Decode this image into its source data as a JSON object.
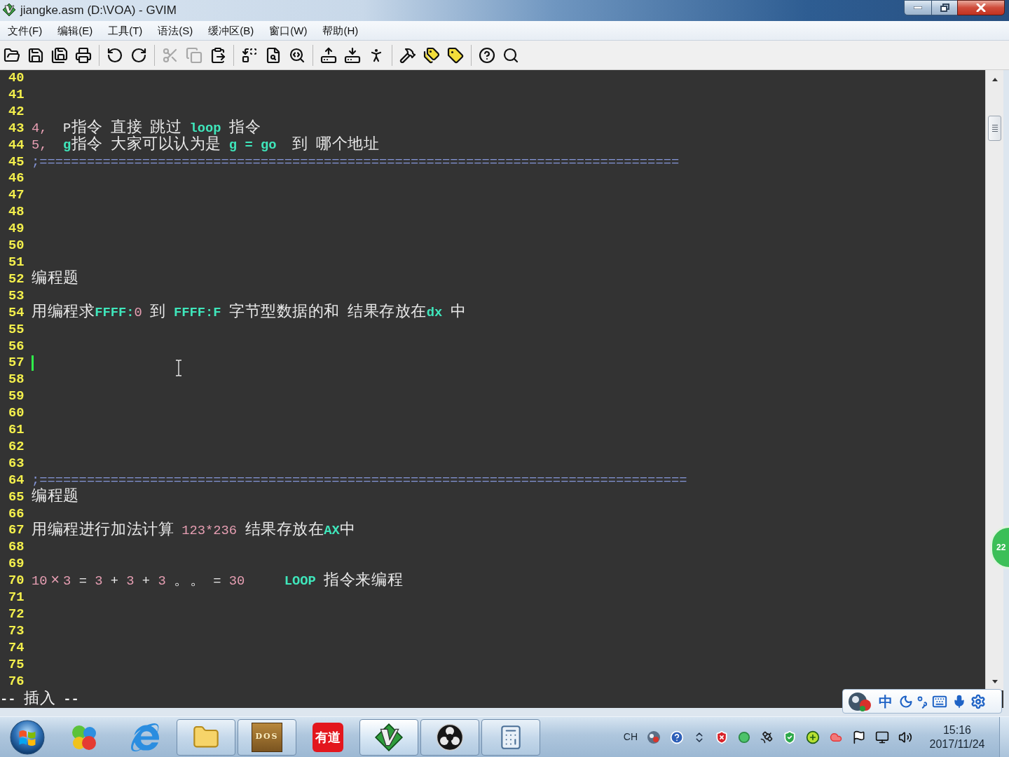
{
  "window": {
    "title": "jiangke.asm (D:\\VOA) - GVIM"
  },
  "menu": [
    "文件(F)",
    "编辑(E)",
    "工具(T)",
    "语法(S)",
    "缓冲区(B)",
    "窗口(W)",
    "帮助(H)"
  ],
  "toolbar": [
    {
      "buttons": [
        {
          "disabled": false
        },
        {
          "disabled": false
        },
        {
          "disabled": false
        },
        {
          "disabled": false
        }
      ]
    },
    {
      "buttons": [
        {
          "disabled": false
        },
        {
          "disabled": false
        }
      ]
    },
    {
      "buttons": [
        {
          "disabled": true
        },
        {
          "disabled": true
        },
        {
          "disabled": false
        }
      ]
    },
    {
      "buttons": [
        {
          "disabled": false
        },
        {
          "disabled": false
        },
        {
          "disabled": false
        }
      ]
    },
    {
      "buttons": [
        {
          "disabled": false
        },
        {
          "disabled": false
        },
        {
          "disabled": false
        }
      ]
    },
    {
      "buttons": [
        {
          "disabled": false
        },
        {
          "disabled": false
        },
        {
          "disabled": false
        }
      ]
    },
    {
      "buttons": [
        {
          "disabled": false
        },
        {
          "disabled": false
        }
      ]
    }
  ],
  "editor": {
    "lines": [
      {
        "number": "40",
        "cursor": false
      },
      {
        "number": "41",
        "cursor": false
      },
      {
        "number": "42",
        "cursor": false
      },
      {
        "number": "43",
        "cursor": false,
        "segments": [
          {
            "text": "4,",
            "kind": "number"
          },
          {
            "text": "  P指令 直接 跳过 ",
            "kind": "plain"
          },
          {
            "text": "loop",
            "kind": "keyword"
          },
          {
            "text": " 指令",
            "kind": "plain"
          }
        ]
      },
      {
        "number": "44",
        "cursor": false,
        "segments": [
          {
            "text": "5,",
            "kind": "number"
          },
          {
            "text": "  g",
            "kind": "keyword"
          },
          {
            "text": "指令 大家可以认为是 ",
            "kind": "plain"
          },
          {
            "text": "g = go",
            "kind": "keyword"
          },
          {
            "text": "  到 哪个地址",
            "kind": "plain"
          }
        ]
      },
      {
        "number": "45",
        "cursor": false,
        "segments": [
          {
            "text": ";=================================================================================",
            "kind": "comment"
          }
        ]
      },
      {
        "number": "46",
        "cursor": false
      },
      {
        "number": "47",
        "cursor": false
      },
      {
        "number": "48",
        "cursor": false
      },
      {
        "number": "49",
        "cursor": false
      },
      {
        "number": "50",
        "cursor": false
      },
      {
        "number": "51",
        "cursor": false
      },
      {
        "number": "52",
        "cursor": false,
        "segments": [
          {
            "text": "编程题",
            "kind": "plain"
          }
        ]
      },
      {
        "number": "53",
        "cursor": false
      },
      {
        "number": "54",
        "cursor": false,
        "segments": [
          {
            "text": "用编程求",
            "kind": "plain"
          },
          {
            "text": "FFFF:",
            "kind": "keyword"
          },
          {
            "text": "0",
            "kind": "number"
          },
          {
            "text": " 到 ",
            "kind": "plain"
          },
          {
            "text": "FFFF:F",
            "kind": "keyword"
          },
          {
            "text": " 字节型数据的和 结果存放在",
            "kind": "plain"
          },
          {
            "text": "dx",
            "kind": "keyword"
          },
          {
            "text": " 中",
            "kind": "plain"
          }
        ]
      },
      {
        "number": "55",
        "cursor": false
      },
      {
        "number": "56",
        "cursor": false
      },
      {
        "number": "57",
        "cursor": true
      },
      {
        "number": "58",
        "cursor": false
      },
      {
        "number": "59",
        "cursor": false
      },
      {
        "number": "60",
        "cursor": false
      },
      {
        "number": "61",
        "cursor": false
      },
      {
        "number": "62",
        "cursor": false
      },
      {
        "number": "63",
        "cursor": false
      },
      {
        "number": "64",
        "cursor": false,
        "segments": [
          {
            "text": ";==================================================================================",
            "kind": "comment"
          }
        ]
      },
      {
        "number": "65",
        "cursor": false,
        "segments": [
          {
            "text": "编程题",
            "kind": "plain"
          }
        ]
      },
      {
        "number": "66",
        "cursor": false
      },
      {
        "number": "67",
        "cursor": false,
        "segments": [
          {
            "text": "用编程进行加法计算 ",
            "kind": "plain"
          },
          {
            "text": "123*236",
            "kind": "number"
          },
          {
            "text": " 结果存放在",
            "kind": "plain"
          },
          {
            "text": "AX",
            "kind": "keyword"
          },
          {
            "text": "中",
            "kind": "plain"
          }
        ]
      },
      {
        "number": "68",
        "cursor": false
      },
      {
        "number": "69",
        "cursor": false
      },
      {
        "number": "70",
        "cursor": false,
        "segments": [
          {
            "text": "10×3",
            "kind": "number"
          },
          {
            "text": " = ",
            "kind": "plain"
          },
          {
            "text": "3",
            "kind": "number"
          },
          {
            "text": " + ",
            "kind": "plain"
          },
          {
            "text": "3",
            "kind": "number"
          },
          {
            "text": " + ",
            "kind": "plain"
          },
          {
            "text": "3",
            "kind": "number"
          },
          {
            "text": " 。。 = ",
            "kind": "plain"
          },
          {
            "text": "30",
            "kind": "number"
          },
          {
            "text": "     LOOP",
            "kind": "keyword"
          },
          {
            "text": " 指令来编程",
            "kind": "plain"
          }
        ]
      },
      {
        "number": "71",
        "cursor": false
      },
      {
        "number": "72",
        "cursor": false
      },
      {
        "number": "73",
        "cursor": false
      },
      {
        "number": "74",
        "cursor": false
      },
      {
        "number": "75",
        "cursor": false
      },
      {
        "number": "76",
        "cursor": false
      }
    ],
    "status_line": "-- 插入 --"
  },
  "ime_bar": {
    "mode": "中"
  },
  "floating_ball": {
    "text": "22"
  },
  "taskbar": {
    "apps": [
      {
        "running": false,
        "selected": false
      },
      {
        "running": false,
        "selected": false
      },
      {
        "running": true,
        "selected": false
      },
      {
        "running": true,
        "selected": false,
        "logo_text": "DOS"
      },
      {
        "running": false,
        "selected": false,
        "logo_text": "有道"
      },
      {
        "running": true,
        "selected": true
      },
      {
        "running": true,
        "selected": false
      },
      {
        "running": true,
        "selected": false
      }
    ],
    "tray": {
      "language": "CH",
      "time": "15:16",
      "date": "2017/11/24"
    }
  }
}
